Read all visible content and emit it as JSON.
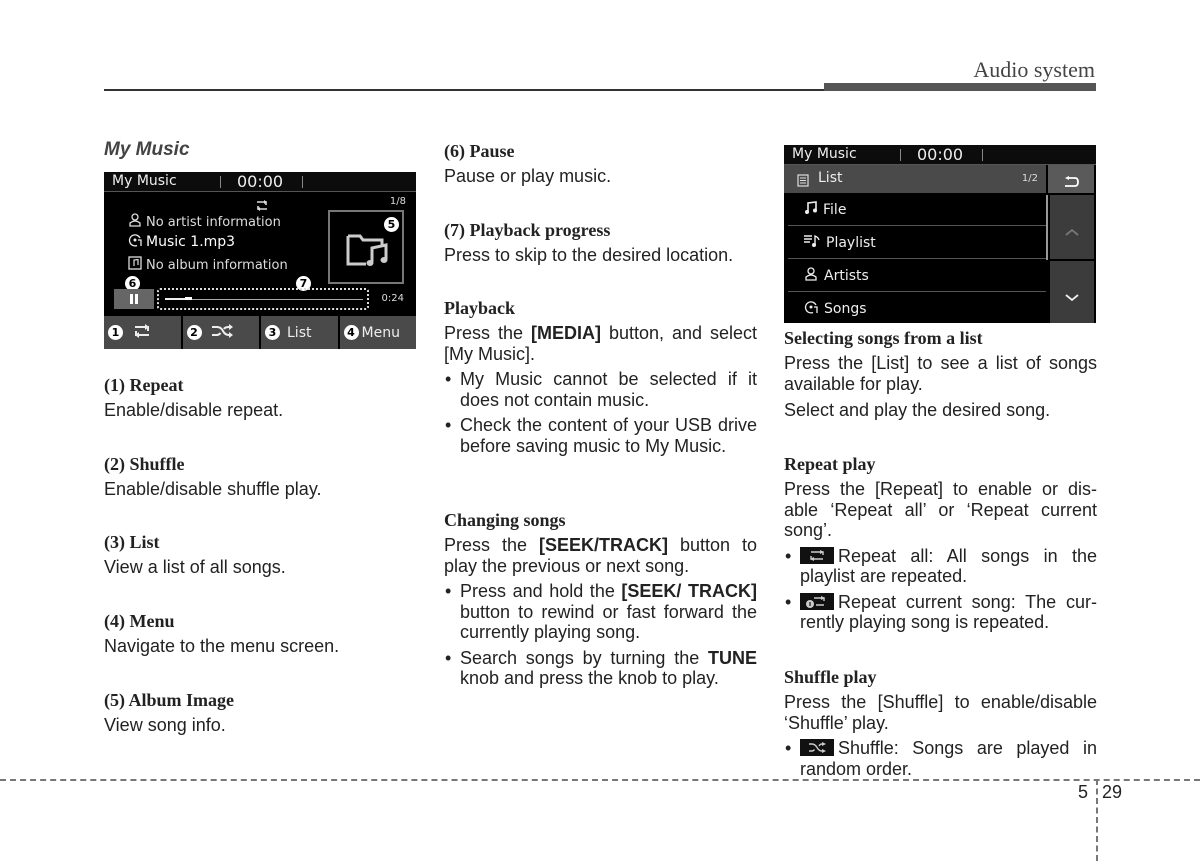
{
  "header": {
    "title": "Audio system"
  },
  "footer": {
    "section": "5",
    "page": "29"
  },
  "col1": {
    "section_title": "My Music",
    "items": [
      {
        "heading": "(1) Repeat",
        "text": "Enable/disable repeat."
      },
      {
        "heading": "(2) Shuffle",
        "text": "Enable/disable shuffle play."
      },
      {
        "heading": "(3) List",
        "text": "View a list of all songs."
      },
      {
        "heading": "(4) Menu",
        "text": "Navigate to the menu screen."
      },
      {
        "heading": "(5) Album Image",
        "text": "View song info."
      }
    ]
  },
  "player_screen": {
    "title": "My Music",
    "clock": "00:00",
    "track_count": "1/8",
    "artist": "No artist information",
    "song": "Music 1.mp3",
    "album": "No album information",
    "elapsed": "0:24",
    "progress_fraction": 0.1,
    "callouts": {
      "album_image": "5",
      "pause": "6",
      "progress": "7"
    },
    "buttons": [
      {
        "badge": "1",
        "label": "",
        "icon": "repeat-icon"
      },
      {
        "badge": "2",
        "label": "",
        "icon": "shuffle-icon"
      },
      {
        "badge": "3",
        "label": "List"
      },
      {
        "badge": "4",
        "label": "Menu"
      }
    ]
  },
  "col2": {
    "items": [
      {
        "heading": "(6) Pause",
        "text": "Pause or play music."
      },
      {
        "heading": "(7) Playback progress",
        "text": "Press to skip to the desired location."
      }
    ],
    "playback": {
      "heading": "Playback",
      "text_pre": "Press the ",
      "text_bold": "[MEDIA]",
      "text_post": " button, and select [My Music].",
      "bullets": [
        "My Music cannot be selected if it does not contain music.",
        "Check the content of your USB drive before saving music to My Music."
      ]
    },
    "changing": {
      "heading": "Changing songs",
      "text_pre": "Press the ",
      "text_bold": "[SEEK/TRACK]",
      "text_post": " button to play the previous or next song.",
      "bullet1_pre": "Press and hold the ",
      "bullet1_bold": "[SEEK/ TRACK]",
      "bullet1_post": " button to rewind or fast forward the currently playing song.",
      "bullet2_pre": "Search songs by turning the ",
      "bullet2_bold": "TUNE",
      "bullet2_post": " knob and press the knob to play."
    }
  },
  "list_screen": {
    "title": "My Music",
    "clock": "00:00",
    "list_label": "List",
    "page_count": "1/2",
    "rows": [
      {
        "label": "File",
        "icon": "music-note-icon"
      },
      {
        "label": "Playlist",
        "icon": "playlist-icon"
      },
      {
        "label": "Artists",
        "icon": "artist-icon"
      },
      {
        "label": "Songs",
        "icon": "song-disc-icon"
      }
    ]
  },
  "col3": {
    "selecting": {
      "heading": "Selecting songs from a list",
      "p1": "Press the [List] to see a list of songs available for play.",
      "p2": "Select and play the desired song."
    },
    "repeat": {
      "heading": "Repeat play",
      "text": "Press the [Repeat] to enable or dis-able ‘Repeat all’ or ‘Repeat current song’.",
      "bullet1": "Repeat all: All songs in the playlist are repeated.",
      "bullet2": "Repeat current song: The cur-rently playing song is repeated."
    },
    "shuffle": {
      "heading": "Shuffle play",
      "text": "Press the [Shuffle] to enable/disable ‘Shuffle’ play.",
      "bullet1": "Shuffle: Songs are played in random order."
    }
  }
}
